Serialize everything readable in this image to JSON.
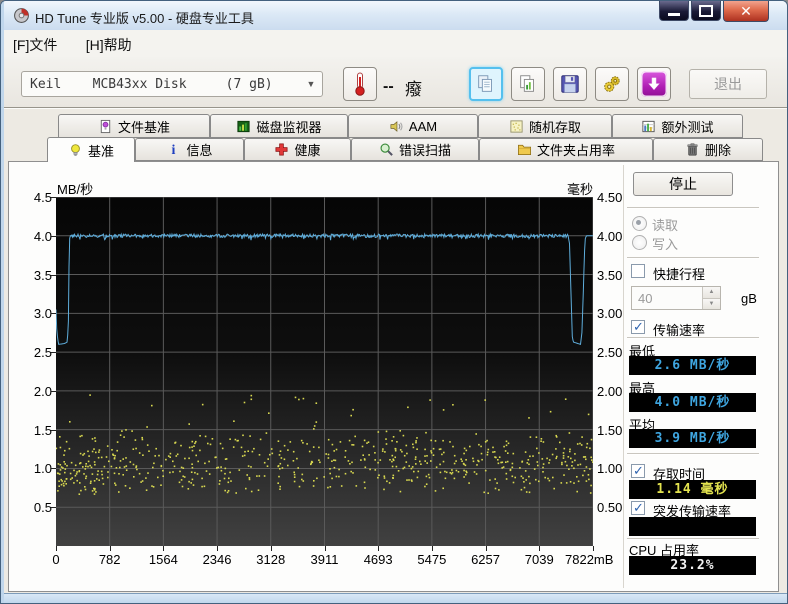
{
  "window": {
    "title": "HD Tune 专业版 v5.00 - 硬盘专业工具"
  },
  "menu": {
    "items": [
      {
        "label": "[F]文件"
      },
      {
        "label": "[H]帮助"
      }
    ]
  },
  "toolbar": {
    "device_select": {
      "value": "Keil    MCB43xx Disk     (7 gB)"
    },
    "temperature": {
      "value": "--",
      "unit": "癈"
    },
    "exit_label": "退出"
  },
  "tabs": {
    "top": [
      {
        "label": "文件基准"
      },
      {
        "label": "磁盘监视器"
      },
      {
        "label": "AAM"
      },
      {
        "label": "随机存取"
      },
      {
        "label": "额外测试"
      }
    ],
    "bottom": [
      {
        "label": "基准",
        "active": true
      },
      {
        "label": "信息"
      },
      {
        "label": "健康"
      },
      {
        "label": "错误扫描"
      },
      {
        "label": "文件夹占用率"
      },
      {
        "label": "删除"
      }
    ]
  },
  "controls": {
    "stop": "停止",
    "read": "读取",
    "write": "写入",
    "short_stroke": "快捷行程",
    "short_stroke_value": "40",
    "short_stroke_unit": "gB",
    "transfer_rate": "传输速率",
    "min_label": "最低",
    "min_value": "2.6 MB/秒",
    "max_label": "最高",
    "max_value": "4.0 MB/秒",
    "avg_label": "平均",
    "avg_value": "3.9 MB/秒",
    "access_time": "存取时间",
    "access_value": "1.14 毫秒",
    "burst_rate": "突发传输速率",
    "burst_value": "",
    "cpu_label": "CPU 占用率",
    "cpu_value": "23.2%"
  },
  "chart_data": {
    "type": "line+scatter",
    "title": "",
    "x_axis": {
      "max": 7822,
      "tick_values": [
        0,
        782,
        1564,
        2346,
        3128,
        3911,
        4693,
        5475,
        6257,
        7039,
        7822
      ],
      "tick_labels": [
        "0",
        "782",
        "1564",
        "2346",
        "3128",
        "3911",
        "4693",
        "5475",
        "6257",
        "7039",
        "7822mB"
      ]
    },
    "y_left_axis": {
      "label": "MB/秒",
      "min": 0,
      "max": 4.5,
      "tick_values": [
        4.5,
        4.0,
        3.5,
        3.0,
        2.5,
        2.0,
        1.5,
        1.0,
        0.5
      ],
      "tick_labels": [
        "4.5",
        "4.0",
        "3.5",
        "3.0",
        "2.5",
        "2.0",
        "1.5",
        "1.0",
        "0.5"
      ]
    },
    "y_right_axis": {
      "label": "毫秒",
      "tick_labels": [
        "4.50",
        "4.00",
        "3.50",
        "3.00",
        "2.50",
        "2.00",
        "1.50",
        "1.00",
        "0.50"
      ]
    },
    "grid_color": "#5A5A5A",
    "series": [
      {
        "name": "transfer_rate_MBps",
        "type": "line",
        "color": "#5FAEDC",
        "anchor_points": [
          [
            0,
            3.05
          ],
          [
            10,
            2.8
          ],
          [
            25,
            2.66
          ],
          [
            40,
            2.6
          ],
          [
            120,
            2.61
          ],
          [
            165,
            2.63
          ],
          [
            180,
            2.9
          ],
          [
            195,
            3.95
          ],
          [
            210,
            4.0
          ],
          [
            7460,
            4.0
          ],
          [
            7480,
            3.9
          ],
          [
            7500,
            3.3
          ],
          [
            7520,
            2.7
          ],
          [
            7535,
            2.63
          ],
          [
            7640,
            2.6
          ],
          [
            7660,
            2.75
          ],
          [
            7685,
            3.4
          ],
          [
            7705,
            3.95
          ],
          [
            7725,
            4.0
          ],
          [
            7822,
            4.0
          ]
        ],
        "noise_amplitude": 0.022,
        "noise_range": [
          210,
          7460
        ],
        "summary": {
          "min_MBps": 2.6,
          "max_MBps": 4.0,
          "avg_MBps": 3.9
        }
      },
      {
        "name": "access_time_ms",
        "type": "scatter",
        "color": "#D9D950",
        "point_count": 620,
        "band_center": 1.08,
        "band_halfwidth": 0.45,
        "y_clamp": [
          0.62,
          1.52
        ],
        "left_cluster": {
          "count": 45,
          "x_max": 750,
          "y_range": [
            0.66,
            1.06
          ]
        },
        "outliers": {
          "count": 28,
          "y_range": [
            1.5,
            1.95
          ]
        },
        "summary": {
          "avg_access_time_ms": 1.14
        },
        "seed": 1234
      }
    ]
  }
}
